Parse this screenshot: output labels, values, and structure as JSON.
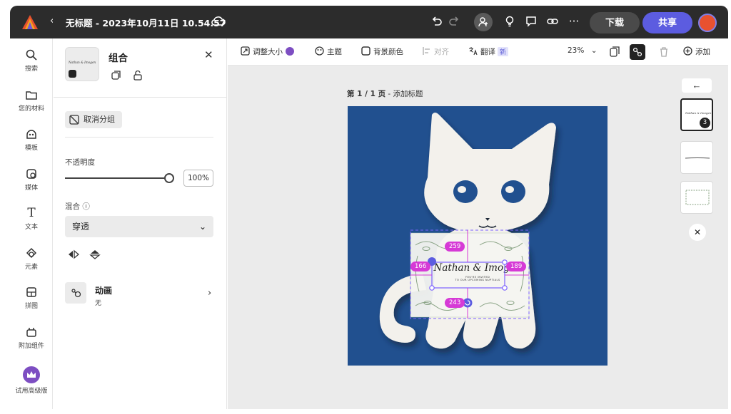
{
  "topbar": {
    "back": "‹",
    "title": "无标题 - 2023年10月11日 10.54.57",
    "download": "下载",
    "share": "共享",
    "more": "···"
  },
  "rail": {
    "items": [
      {
        "label": "搜索",
        "icon": "search-icon"
      },
      {
        "label": "您的材料",
        "icon": "folder-icon"
      },
      {
        "label": "模板",
        "icon": "template-icon"
      },
      {
        "label": "媒体",
        "icon": "media-icon"
      },
      {
        "label": "文本",
        "icon": "text-icon"
      },
      {
        "label": "元素",
        "icon": "elements-icon"
      },
      {
        "label": "拼图",
        "icon": "grid-icon"
      },
      {
        "label": "附加组件",
        "icon": "addon-icon"
      },
      {
        "label": "试用高级版",
        "icon": "crown-icon"
      }
    ],
    "text_glyph": "T"
  },
  "panel": {
    "title": "组合",
    "close": "✕",
    "thumb_text": "Nathan & Imogen",
    "ungroup": "取消分组",
    "opacity_label": "不透明度",
    "opacity_value": "100%",
    "opacity": 1.0,
    "blend_label": "混合 ⓘ",
    "blend_value": "穿透",
    "animation_title": "动画",
    "animation_value": "无",
    "chevron": "›",
    "select_chevron": "⌄"
  },
  "toolbar": {
    "resize": "调整大小",
    "theme": "主题",
    "bg_color": "背景颜色",
    "align": "对齐",
    "translate": "翻译",
    "translate_badge": "新",
    "zoom": "23%",
    "zoom_chevron": "⌄",
    "add": "添加"
  },
  "canvas": {
    "page_label_bold": "第 1 / 1 页",
    "page_label_rest": " - 添加标题",
    "card_title": "Nathan & Imogen",
    "card_subtitle": "YOU'RE INVITED\nTO OUR UPCOMING NUPTIALS",
    "measure_top": "259",
    "measure_left": "166",
    "measure_right": "189",
    "measure_bottom": "243"
  },
  "pages": {
    "back": "←",
    "thumb_text": "Nathan & Imogen",
    "count": "3",
    "close": "✕"
  },
  "colors": {
    "topbar": "#2c2c2c",
    "share": "#5c5ce0",
    "artboard_bg": "#21508f",
    "selection": "#7b61ff",
    "measure_tag": "#d63ad6",
    "crown": "#7d4ec2"
  }
}
